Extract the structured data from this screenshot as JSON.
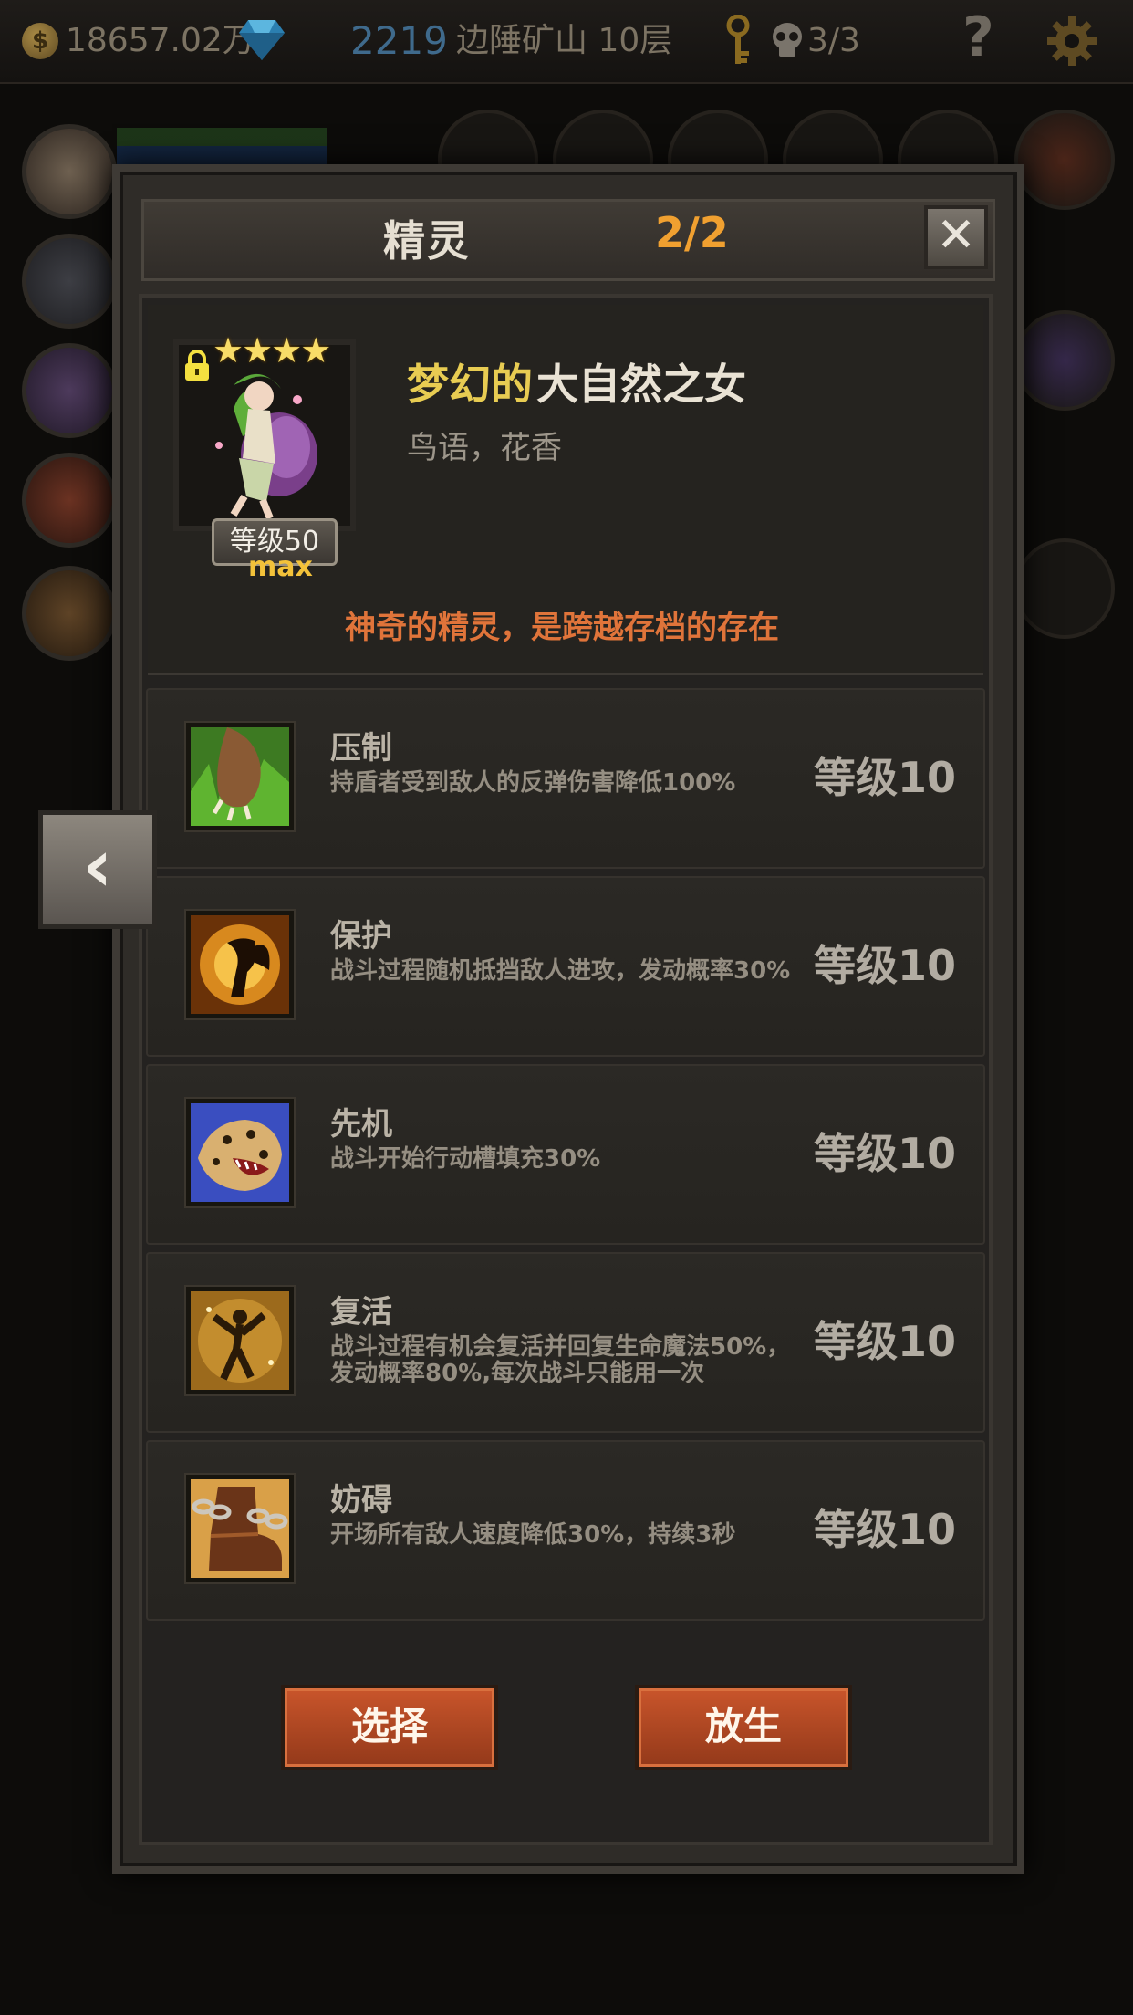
{
  "topbar": {
    "gold": "18657.02万",
    "gems": "2219",
    "location": "边陲矿山 10层",
    "skull_count": "3/3",
    "help": "?"
  },
  "dialog": {
    "title": "精灵",
    "count": "2/2",
    "close": "✕",
    "spirit": {
      "stars": "★★★★",
      "level_badge": "等级50",
      "max_label": "max",
      "name_prefix": "梦幻的",
      "name_main": "大自然之女",
      "subtitle": "鸟语，花香",
      "description": "神奇的精灵，是跨越存档的存在"
    },
    "skills": [
      {
        "name": "压制",
        "desc": "持盾者受到敌人的反弹伤害降低100%",
        "level": "等级10",
        "icon": "paw-icon"
      },
      {
        "name": "保护",
        "desc": "战斗过程随机抵挡敌人进攻，发动概率30%",
        "level": "等级10",
        "icon": "fairy-shield-icon"
      },
      {
        "name": "先机",
        "desc": "战斗开始行动槽填充30%",
        "level": "等级10",
        "icon": "leopard-icon"
      },
      {
        "name": "复活",
        "desc": "战斗过程有机会复活并回复生命魔法50%，发动概率80%,每次战斗只能用一次",
        "level": "等级10",
        "icon": "revive-icon"
      },
      {
        "name": "妨碍",
        "desc": "开场所有敌人速度降低30%，持续3秒",
        "level": "等级10",
        "icon": "chained-boot-icon"
      }
    ],
    "buttons": {
      "select": "选择",
      "release": "放生"
    },
    "nav_prev": "‹"
  },
  "colors": {
    "accent_orange": "#f0a030",
    "name_gold": "#e8cc52",
    "desc_orange": "#e0743a",
    "button_red": "#b8482a"
  }
}
